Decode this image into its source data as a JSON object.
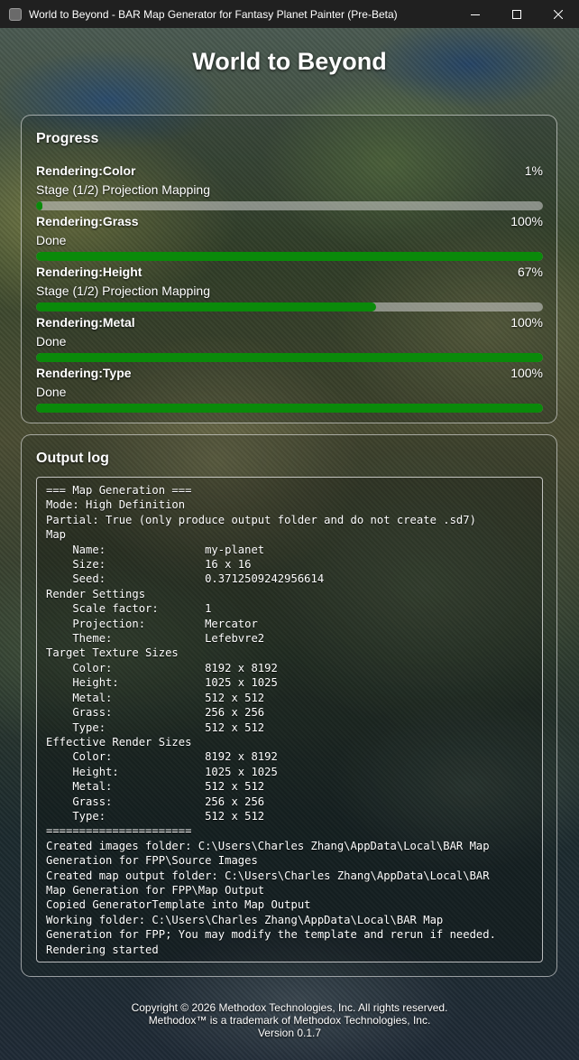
{
  "window": {
    "title": "World to Beyond - BAR Map Generator for Fantasy Planet Painter (Pre-Beta)"
  },
  "app_title": "World to Beyond",
  "progress": {
    "heading": "Progress",
    "jobs": [
      {
        "name": "Rendering:Color",
        "percent_label": "1%",
        "value": 1,
        "status": "Stage (1/2) Projection Mapping"
      },
      {
        "name": "Rendering:Grass",
        "percent_label": "100%",
        "value": 100,
        "status": "Done"
      },
      {
        "name": "Rendering:Height",
        "percent_label": "67%",
        "value": 67,
        "status": "Stage (1/2) Projection Mapping"
      },
      {
        "name": "Rendering:Metal",
        "percent_label": "100%",
        "value": 100,
        "status": "Done"
      },
      {
        "name": "Rendering:Type",
        "percent_label": "100%",
        "value": 100,
        "status": "Done"
      }
    ]
  },
  "log": {
    "heading": "Output log",
    "lines": [
      "=== Map Generation ===",
      "Mode: High Definition",
      "Partial: True (only produce output folder and do not create .sd7)",
      "Map",
      "    Name:               my-planet",
      "    Size:               16 x 16",
      "    Seed:               0.3712509242956614",
      "Render Settings",
      "    Scale factor:       1",
      "    Projection:         Mercator",
      "    Theme:              Lefebvre2",
      "Target Texture Sizes",
      "    Color:              8192 x 8192",
      "    Height:             1025 x 1025",
      "    Metal:              512 x 512",
      "    Grass:              256 x 256",
      "    Type:               512 x 512",
      "Effective Render Sizes",
      "    Color:              8192 x 8192",
      "    Height:             1025 x 1025",
      "    Metal:              512 x 512",
      "    Grass:              256 x 256",
      "    Type:               512 x 512",
      "======================",
      "Created images folder: C:\\Users\\Charles Zhang\\AppData\\Local\\BAR Map",
      "Generation for FPP\\Source Images",
      "Created map output folder: C:\\Users\\Charles Zhang\\AppData\\Local\\BAR",
      "Map Generation for FPP\\Map Output",
      "Copied GeneratorTemplate into Map Output",
      "Working folder: C:\\Users\\Charles Zhang\\AppData\\Local\\BAR Map",
      "Generation for FPP; You may modify the template and rerun if needed.",
      "Rendering started"
    ]
  },
  "footer": {
    "copyright": "Copyright © 2026 Methodox Technologies, Inc. All rights reserved.",
    "trademark": "Methodox™ is a trademark of Methodox Technologies, Inc.",
    "version": "Version 0.1.7"
  },
  "colors": {
    "progress_fill": "#0a8a0a",
    "titlebar": "#202020"
  },
  "icons": [
    "app-icon",
    "minimize-icon",
    "maximize-icon",
    "close-icon"
  ]
}
